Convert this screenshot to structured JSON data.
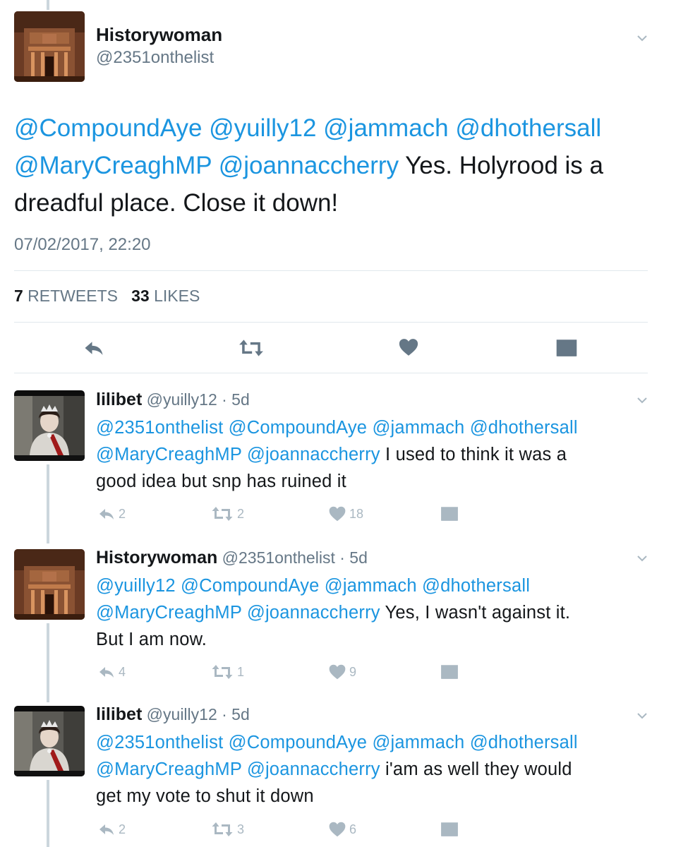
{
  "main_tweet": {
    "name": "Historywoman",
    "handle": "@2351onthelist",
    "mentions_line1": "@CompoundAye @yuilly12 @jammach @dhothersall",
    "mentions_line2": "@MaryCreaghMP @joannaccherry",
    "text_line2": " Yes. Holyrood is a",
    "text_line3": "dreadful place. Close it down!",
    "timestamp": "07/02/2017, 22:20",
    "retweets_count": "7",
    "retweets_label": " RETWEETS",
    "likes_count": "33",
    "likes_label": " LIKES"
  },
  "icons": {
    "reply": "reply-arrow-icon",
    "retweet": "retweet-icon",
    "like": "heart-icon",
    "dm": "envelope-icon",
    "more": "chevron-down-icon"
  },
  "colors": {
    "mention": "#1b95e0",
    "muted": "#657786",
    "action_main": "#657786",
    "action_reply": "#aab8c2",
    "divider": "#e1e8ed",
    "thread_line": "#ccd6dd"
  },
  "replies": [
    {
      "name": "lilibet",
      "meta": " @yuilly12 · 5d",
      "mentions_line1": "@2351onthelist @CompoundAye @jammach @dhothersall",
      "mentions_line2": "@MaryCreaghMP @joannaccherry",
      "text_line2": " I used to think it was a",
      "text_line3": "good idea but snp has ruined it",
      "reply_count": "2",
      "retweet_count": "2",
      "like_count": "18"
    },
    {
      "name": "Historywoman",
      "meta": " @2351onthelist · 5d",
      "mentions_line1": "@yuilly12 @CompoundAye @jammach @dhothersall",
      "mentions_line2": "@MaryCreaghMP @joannaccherry",
      "text_line2": " Yes, I wasn't against it.",
      "text_line3": "But I am now.",
      "reply_count": "4",
      "retweet_count": "1",
      "like_count": "9"
    },
    {
      "name": "lilibet",
      "meta": " @yuilly12 · 5d",
      "mentions_line1": "@2351onthelist @CompoundAye @jammach @dhothersall",
      "mentions_line2": "@MaryCreaghMP @joannaccherry",
      "text_line2": " i'am as well they would",
      "text_line3": "get my vote to shut it down",
      "reply_count": "2",
      "retweet_count": "3",
      "like_count": "6"
    }
  ]
}
